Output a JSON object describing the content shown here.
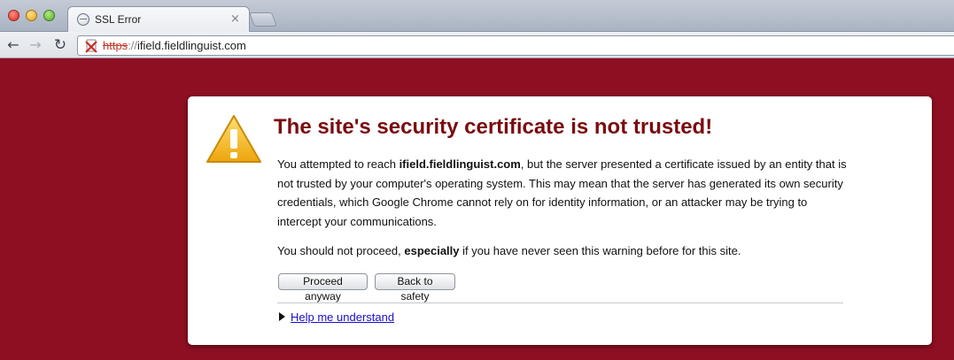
{
  "browser": {
    "tab_title": "SSL Error",
    "tab_close": "×",
    "url_scheme": "https",
    "url_sep": "://",
    "url_host": "ifield.fieldlinguist.com"
  },
  "nav": {
    "back": "←",
    "forward": "→",
    "reload": "↻"
  },
  "interstitial": {
    "heading": "The site's security certificate is not trusted!",
    "p1_before": "You attempted to reach ",
    "p1_host": "ifield.fieldlinguist.com",
    "p1_after": ", but the server presented a certificate issued by an entity that is not trusted by your computer's operating system. This may mean that the server has generated its own security credentials, which Google Chrome cannot rely on for identity information, or an attacker may be trying to intercept your communications.",
    "p2_before": "You should not proceed, ",
    "p2_bold": "especially",
    "p2_after": " if you have never seen this warning before for this site.",
    "proceed_label": "Proceed anyway",
    "back_label": "Back to safety",
    "help_label": "Help me understand"
  },
  "colors": {
    "background": "#8e0f22",
    "heading": "#7a0c10",
    "link": "#1a0dcc",
    "warning_yellow": "#f5c211"
  }
}
